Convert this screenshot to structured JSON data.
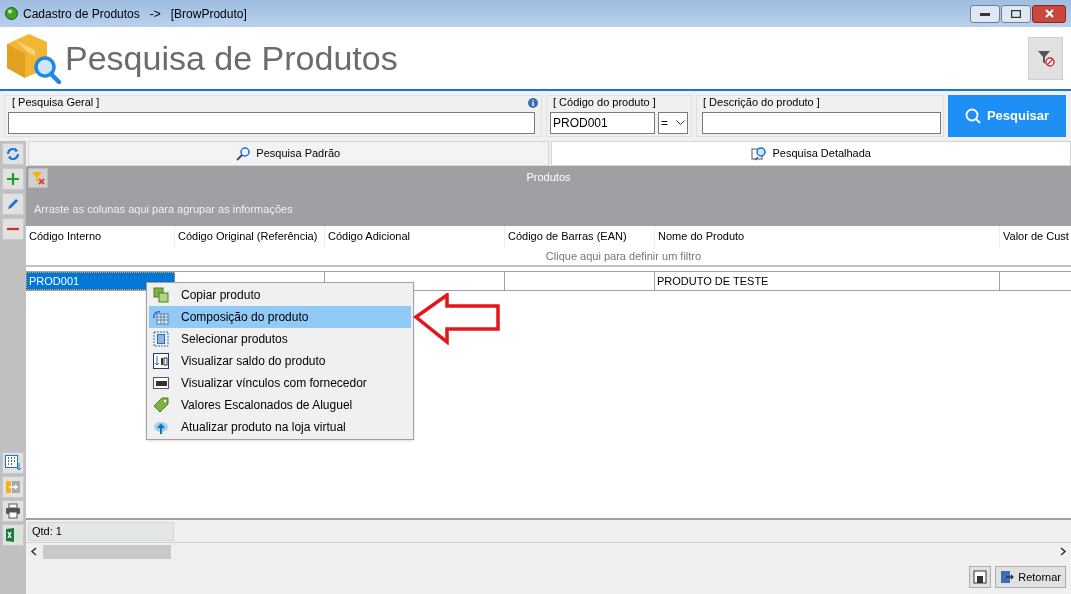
{
  "window": {
    "title": "Cadastro de Produtos   ->   [BrowProduto]"
  },
  "header": {
    "title": "Pesquisa de Produtos"
  },
  "search": {
    "general_label": "[ Pesquisa Geral ]",
    "code_label": "[ Código do produto ]",
    "code_value": "PROD001",
    "operator": "=",
    "description_label": "[ Descrição do produto ]",
    "button": "Pesquisar"
  },
  "tabs": [
    {
      "label": "Pesquisa Padrão",
      "selected": false
    },
    {
      "label": "Pesquisa Detalhada",
      "selected": true
    }
  ],
  "grid": {
    "title": "Produtos",
    "group_hint": "Arraste as colunas aqui para agrupar as informações",
    "filter_hint": "Clique aqui para definir um filtro",
    "columns": [
      "Código Interno",
      "Código Original (Referência)",
      "Código Adicional",
      "Código de Barras (EAN)",
      "Nome do Produto",
      "Valor de Cust"
    ],
    "rows": [
      {
        "cells": [
          "PROD001",
          "",
          "",
          "",
          "PRODUTO DE TESTE",
          ""
        ],
        "selected": true
      }
    ]
  },
  "context_menu": [
    {
      "label": "Copiar produto",
      "kind": "copy",
      "selected": false
    },
    {
      "label": "Composição do produto",
      "kind": "compose",
      "selected": true
    },
    {
      "label": "Selecionar produtos",
      "kind": "select",
      "selected": false
    },
    {
      "label": "Visualizar saldo do produto",
      "kind": "balance",
      "selected": false
    },
    {
      "label": "Visualizar vínculos com fornecedor",
      "kind": "supplier",
      "selected": false
    },
    {
      "label": "Valores Escalonados de Aluguel",
      "kind": "tag",
      "selected": false
    },
    {
      "label": "Atualizar produto na loja virtual",
      "kind": "upload",
      "selected": false
    }
  ],
  "status_bar": {
    "count": "Qtd: 1"
  },
  "footer": {
    "button": "Retornar"
  }
}
